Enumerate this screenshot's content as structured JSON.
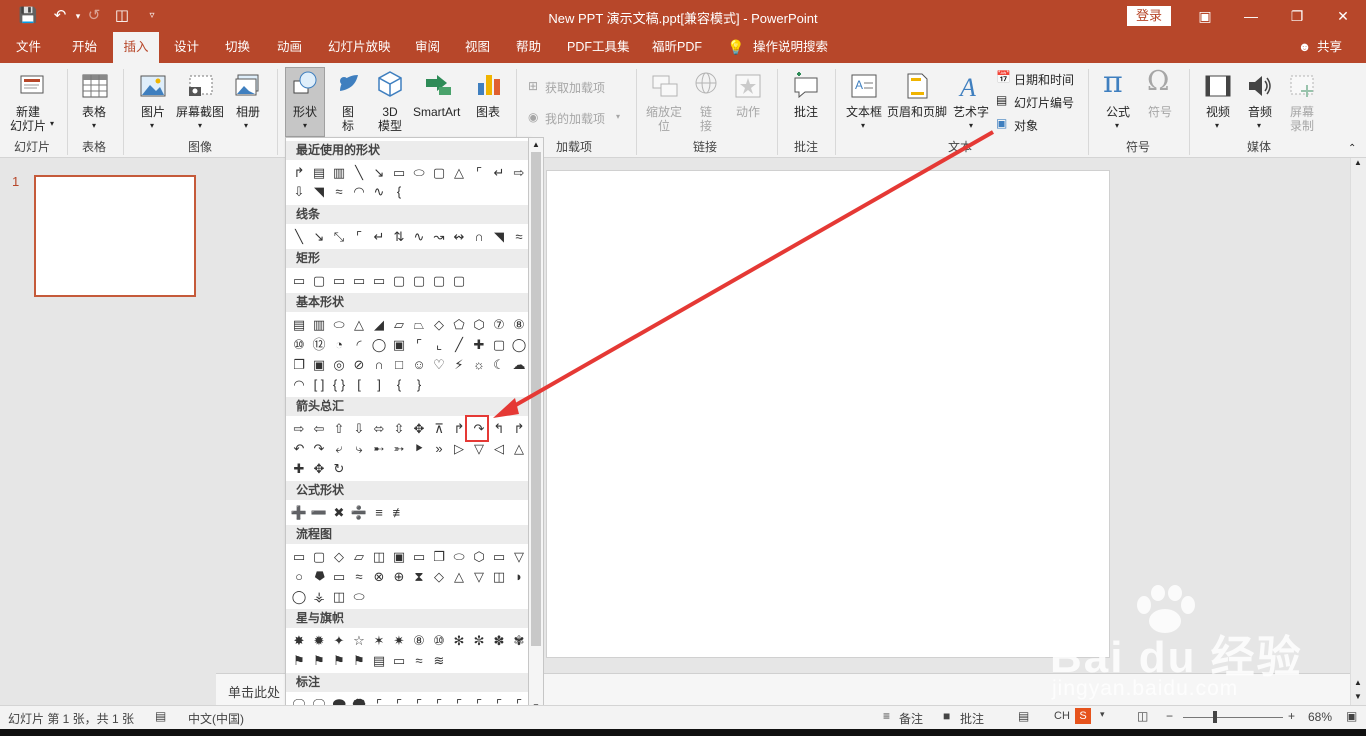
{
  "titlebar": {
    "title": "New PPT 演示文稿.ppt[兼容模式]  -  PowerPoint",
    "login": "登录"
  },
  "menu": {
    "items": [
      "文件",
      "开始",
      "插入",
      "设计",
      "切换",
      "动画",
      "幻灯片放映",
      "审阅",
      "视图",
      "帮助",
      "PDF工具集",
      "福昕PDF"
    ],
    "active": "插入",
    "tell_me": "操作说明搜索",
    "share": "共享"
  },
  "ribbon": {
    "groups": [
      "幻灯片",
      "表格",
      "图像",
      "加载项",
      "链接",
      "批注",
      "文本",
      "符号",
      "媒体"
    ],
    "new_slide": "新建\n幻灯片",
    "table": "表格",
    "pictures": "图片",
    "screenshot": "屏幕截图",
    "album": "相册",
    "shapes": "形状",
    "icons": "图\n标",
    "model3d": "3D\n模型",
    "smartart": "SmartArt",
    "chart": "图表",
    "get_addins": "获取加载项",
    "my_addins": "我的加载项",
    "zoom": "缩放定\n位",
    "link": "链\n接",
    "action": "动作",
    "comment": "批注",
    "textbox": "文本框",
    "header_footer": "页眉和页脚",
    "wordart": "艺术字",
    "datetime": "日期和时间",
    "slide_number": "幻灯片编号",
    "object": "对象",
    "equation": "公式",
    "symbol": "符号",
    "video": "视频",
    "audio": "音频",
    "screen_record": "屏幕\n录制"
  },
  "shapes_panel": {
    "categories": [
      "最近使用的形状",
      "线条",
      "矩形",
      "基本形状",
      "箭头总汇",
      "公式形状",
      "流程图",
      "星与旗帜",
      "标注"
    ]
  },
  "slides": {
    "number": "1"
  },
  "notes": {
    "placeholder": "单击此处"
  },
  "status": {
    "slide_info": "幻灯片 第 1 张，共 1 张",
    "language": "中文(中国)",
    "notes": "备注",
    "comments": "批注",
    "ime": "CH",
    "zoom": "68%"
  },
  "watermark": {
    "brand": "Bai du 经验",
    "url": "jingyan.baidu.com"
  },
  "colors": {
    "accent": "#b7472a",
    "highlight": "#e53935"
  }
}
